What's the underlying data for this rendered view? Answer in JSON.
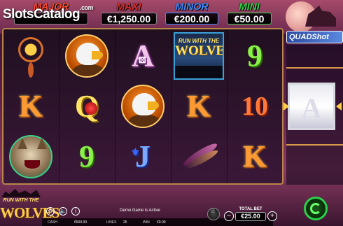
{
  "watermark": {
    "text": "SlotsCatalog",
    "suffix": ".com"
  },
  "jackpots": {
    "major": {
      "title": "MAJOR",
      "value": ""
    },
    "maxi": {
      "title": "MAXI",
      "value": "€1,250.00"
    },
    "minor": {
      "title": "MINOR",
      "value": "€200.00"
    },
    "mini": {
      "title": "MINI",
      "value": "€50.00"
    }
  },
  "reels": {
    "grid": [
      [
        "dreamcatcher",
        "eagle",
        "A",
        "wild",
        "9"
      ],
      [
        "K",
        "Q",
        "eagle",
        "K",
        "10"
      ],
      [
        "lynx",
        "9",
        "J",
        "feathers",
        "K"
      ]
    ],
    "wild_text": {
      "top": "RUN WITH THE",
      "main": "WOLVES"
    }
  },
  "feature": {
    "title": "QUADShot",
    "side_symbol": "A"
  },
  "logo": {
    "top": "RUN WITH THE",
    "main": "WOLVES"
  },
  "status": {
    "message": "Demo Game is Active"
  },
  "bottom_bar": {
    "cash_label": "CASH",
    "cash_value": "€500.00",
    "lines_label": "LINES",
    "lines_value": "25",
    "win_label": "WIN",
    "win_value": "€0.00"
  },
  "bet": {
    "label": "TOTAL BET",
    "value": "€25.00",
    "minus": "−",
    "plus": "+"
  },
  "controls": {
    "info": "i"
  },
  "colors": {
    "frame": "#b8864a",
    "spin": "#2ad04a",
    "minor": "#3a8cff",
    "mini": "#35d04a",
    "major": "#ff4a2a"
  }
}
